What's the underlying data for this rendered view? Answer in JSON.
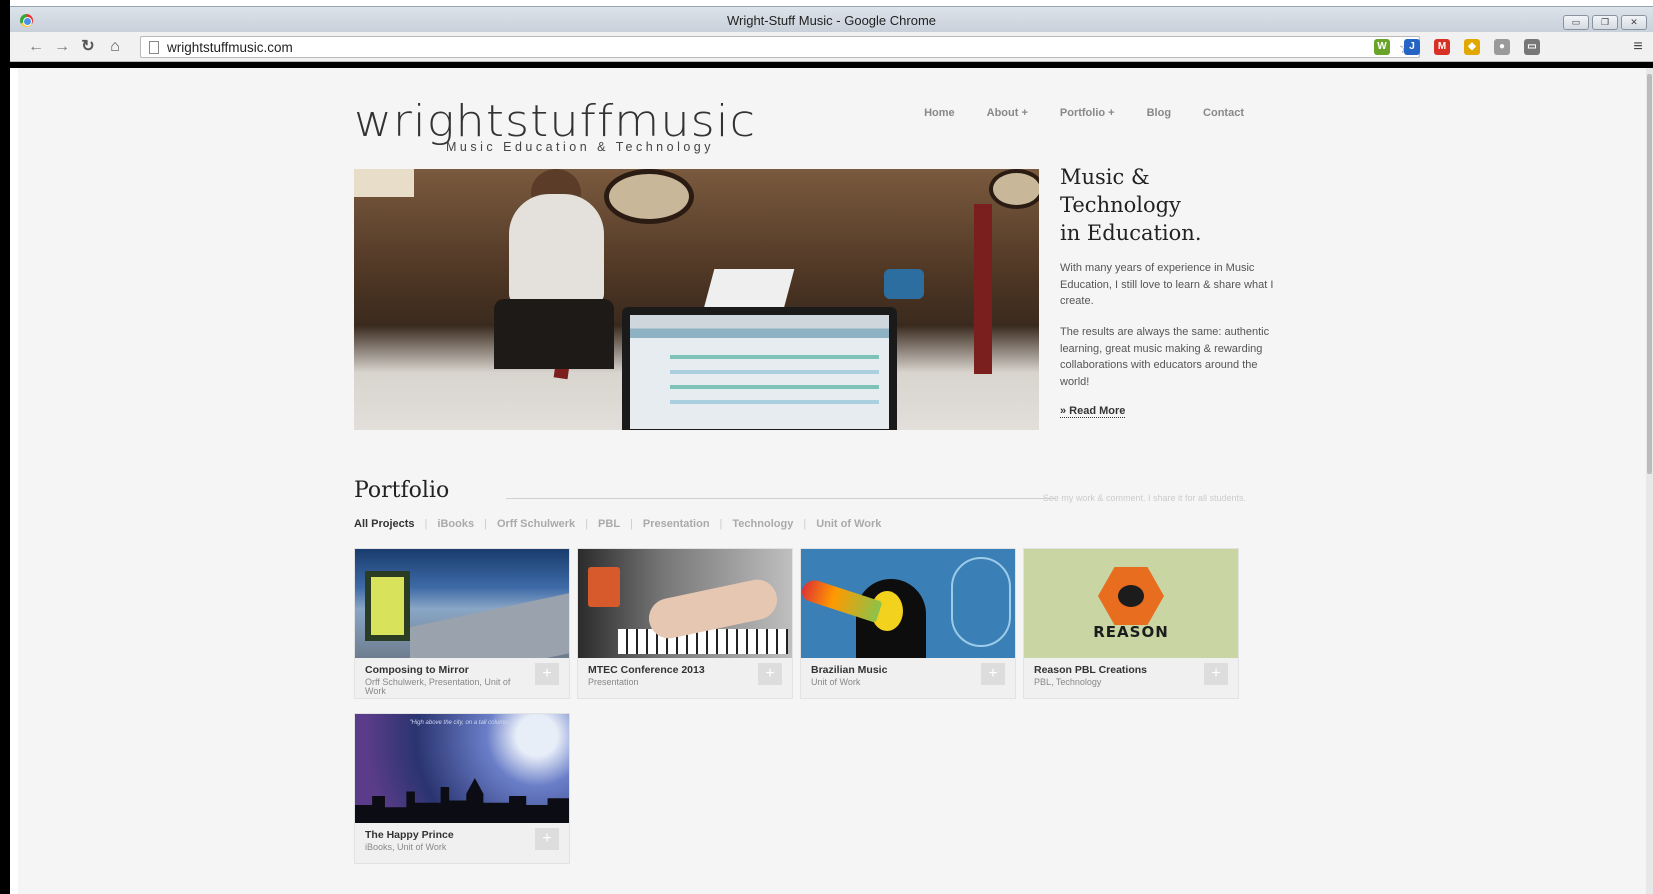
{
  "browser": {
    "window_title": "Wright-Stuff Music - Google Chrome",
    "url": "wrightstuffmusic.com",
    "controls": {
      "minimize": "▭",
      "restore": "❐",
      "close": "✕"
    },
    "extensions": [
      {
        "name": "w-extension-icon",
        "label": "W",
        "color": "#6aa329"
      },
      {
        "name": "pocket-extension-icon",
        "label": "J",
        "color": "#2563c4"
      },
      {
        "name": "gmail-extension-icon",
        "label": "M",
        "color": "#d93025"
      },
      {
        "name": "tag-extension-icon",
        "label": "◆",
        "color": "#e0a800"
      },
      {
        "name": "balloon-extension-icon",
        "label": "●",
        "color": "#9a9a9a"
      },
      {
        "name": "cast-extension-icon",
        "label": "▭",
        "color": "#777777"
      }
    ]
  },
  "site": {
    "logo": "wrightstuffmusic",
    "tagline": "Music Education & Technology",
    "nav": [
      "Home",
      "About  +",
      "Portfolio  +",
      "Blog",
      "Contact"
    ]
  },
  "hero": {
    "heading": [
      "Music &",
      "Technology",
      "in Education."
    ],
    "paragraph1": "With many years of experience in Music Education, I still love to learn & share what I create.",
    "paragraph2": "The results are always the same: authentic learning, great music making & rewarding collaborations with educators around the world!",
    "read_more": "» Read More"
  },
  "portfolio": {
    "title": "Portfolio",
    "tagline": "See my work & comment. I share it for all students.",
    "filters": [
      "All Projects",
      "iBooks",
      "Orff Schulwerk",
      "PBL",
      "Presentation",
      "Technology",
      "Unit of Work"
    ],
    "active_filter": "All Projects",
    "items": [
      {
        "title": "Composing to Mirror",
        "categories": "Orff Schulwerk, Presentation, Unit of Work"
      },
      {
        "title": "MTEC Conference 2013",
        "categories": "Presentation"
      },
      {
        "title": "Brazilian Music",
        "categories": "Unit of Work"
      },
      {
        "title": "Reason PBL Creations",
        "categories": "PBL, Technology",
        "thumb_text": "REASON"
      },
      {
        "title": "The Happy Prince",
        "categories": "iBooks, Unit of Work",
        "thumb_text": "\"High above the city, on a tall column...\""
      }
    ],
    "plus_label": "+"
  }
}
